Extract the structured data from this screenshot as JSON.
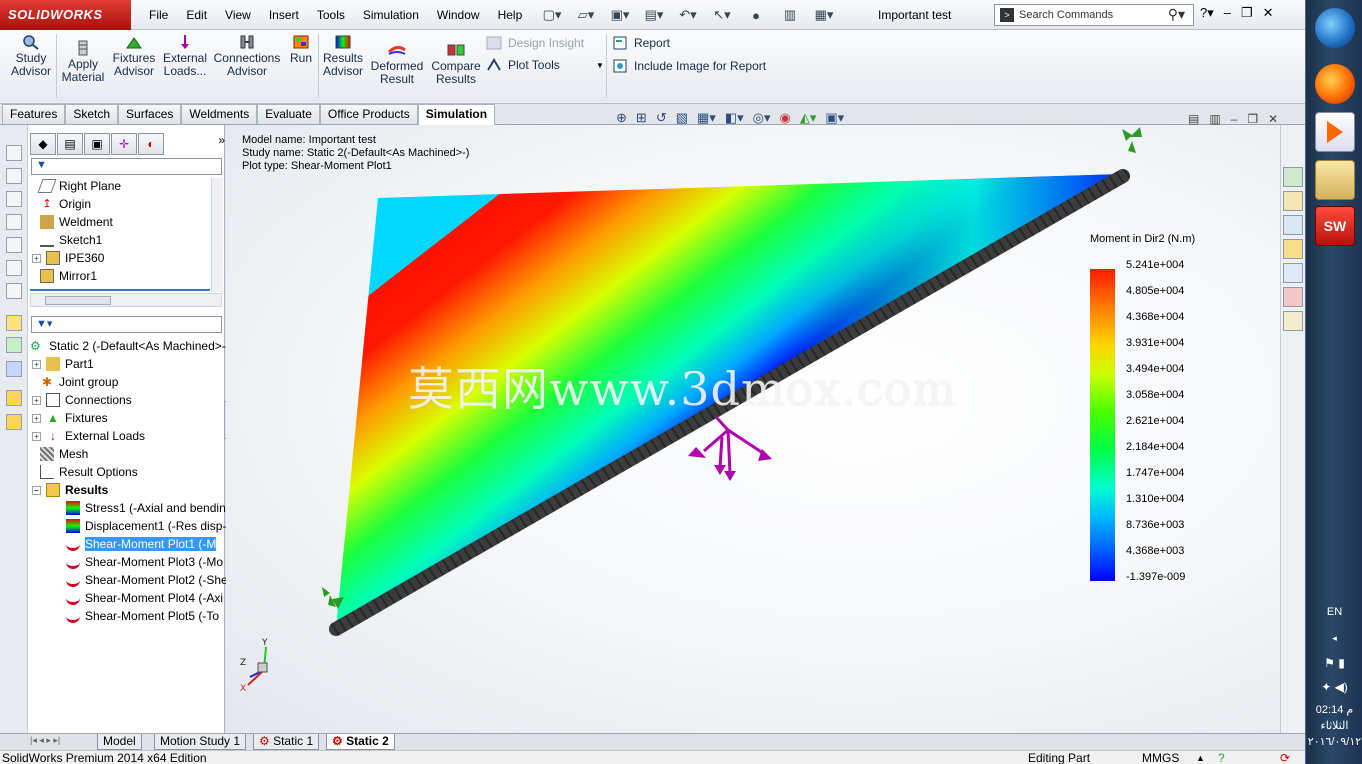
{
  "app": {
    "logo_text": "SOLIDWORKS",
    "document_title": "Important test"
  },
  "menu": [
    "File",
    "Edit",
    "View",
    "Insert",
    "Tools",
    "Simulation",
    "Window",
    "Help"
  ],
  "search": {
    "placeholder": "Search Commands"
  },
  "ribbon": {
    "study_advisor": "Study Advisor",
    "apply_material": "Apply Material",
    "fixtures_advisor": "Fixtures Advisor",
    "external_loads": "External Loads...",
    "connections_advisor": "Connections Advisor",
    "run": "Run",
    "results_advisor": "Results Advisor",
    "deformed_result": "Deformed Result",
    "compare_results": "Compare Results",
    "design_insight": "Design Insight",
    "plot_tools": "Plot Tools",
    "report": "Report",
    "include_image": "Include Image for Report"
  },
  "cmd_tabs": [
    "Features",
    "Sketch",
    "Surfaces",
    "Weldments",
    "Evaluate",
    "Office Products",
    "Simulation"
  ],
  "feature_tree": {
    "items": [
      {
        "label": "Right Plane"
      },
      {
        "label": "Origin"
      },
      {
        "label": "Weldment"
      },
      {
        "label": "Sketch1"
      },
      {
        "label": "IPE360"
      },
      {
        "label": "Mirror1"
      }
    ]
  },
  "study_tree": {
    "root": "Static 2 (-Default<As Machined>-",
    "items": [
      {
        "label": "Part1"
      },
      {
        "label": "Joint group"
      },
      {
        "label": "Connections"
      },
      {
        "label": "Fixtures"
      },
      {
        "label": "External Loads"
      },
      {
        "label": "Mesh"
      },
      {
        "label": "Result Options"
      },
      {
        "label": "Results"
      },
      {
        "label": "Stress1 (-Axial and bendin"
      },
      {
        "label": "Displacement1 (-Res disp-"
      },
      {
        "label": "Shear-Moment Plot1 (-M"
      },
      {
        "label": "Shear-Moment Plot3 (-Mo"
      },
      {
        "label": "Shear-Moment Plot2 (-She"
      },
      {
        "label": "Shear-Moment Plot4 (-Axi"
      },
      {
        "label": "Shear-Moment Plot5 (-To"
      }
    ]
  },
  "model_info": {
    "model_name": "Model name: Important test",
    "study_name": "Study name: Static 2(-Default<As Machined>-)",
    "plot_type": "Plot type:  Shear-Moment Plot1"
  },
  "legend": {
    "title": "Moment in Dir2 (N.m)",
    "labels": [
      "5.241e+004",
      "4.805e+004",
      "4.368e+004",
      "3.931e+004",
      "3.494e+004",
      "3.058e+004",
      "2.621e+004",
      "2.184e+004",
      "1.747e+004",
      "1.310e+004",
      "8.736e+003",
      "4.368e+003",
      "-1.397e-009"
    ]
  },
  "watermark": "莫西网www.3dmox.com",
  "axes": {
    "x": "X",
    "y": "Y",
    "z": "Z"
  },
  "bottom_tabs": [
    "Model",
    "Motion Study 1",
    "Static 1",
    "Static 2"
  ],
  "status": {
    "edition": "SolidWorks Premium 2014 x64 Edition",
    "mode": "Editing Part",
    "units": "MMGS"
  },
  "taskbar": {
    "lang": "EN",
    "time": "02:14 م",
    "day": "الثلاثاء",
    "date": "٢٠١٦/٠٩/١٢"
  }
}
